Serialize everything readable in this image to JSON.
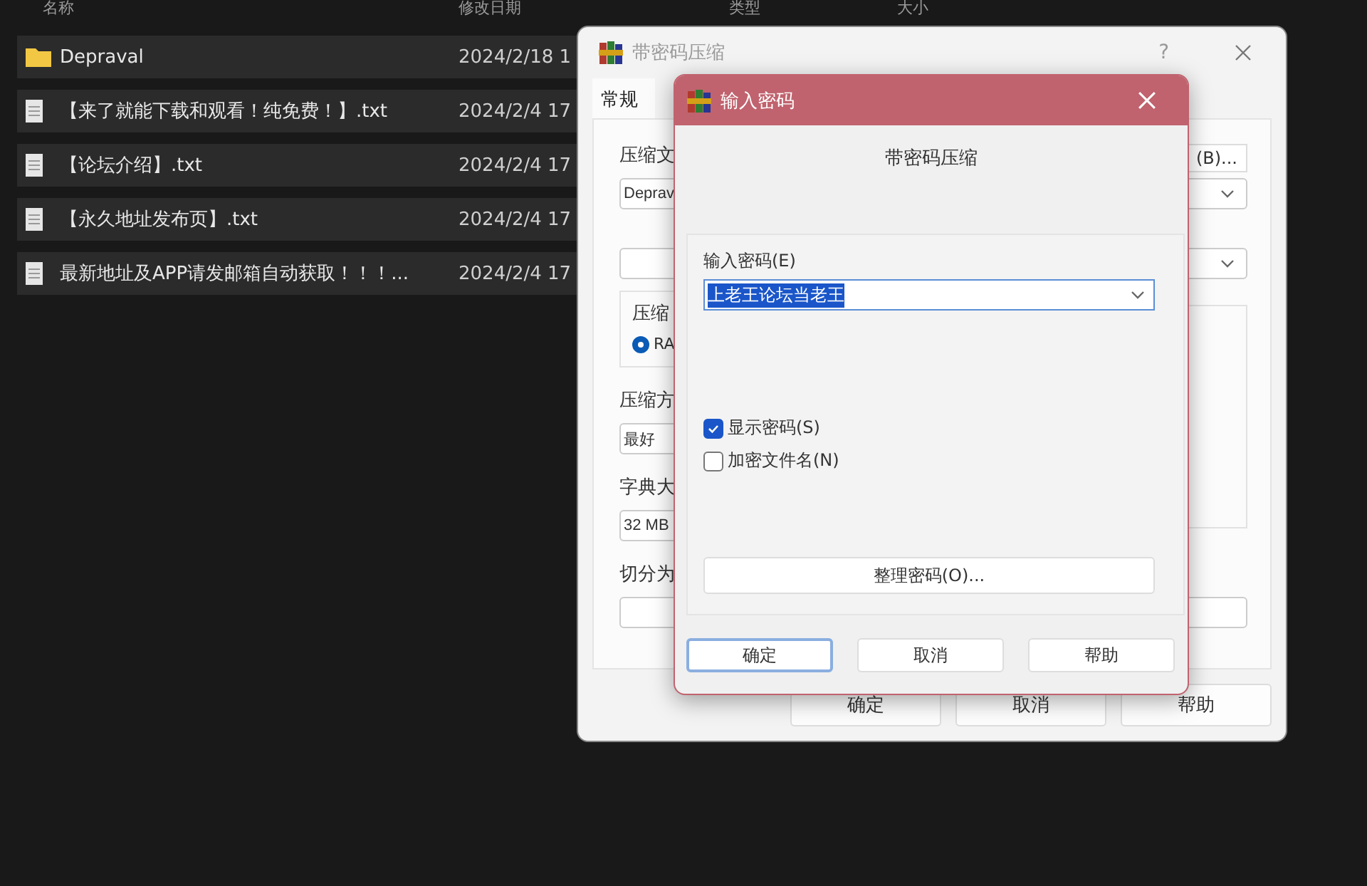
{
  "explorer": {
    "columns": [
      "名称",
      "修改日期",
      "类型",
      "大小"
    ],
    "rows": [
      {
        "kind": "folder",
        "name": "Depraval",
        "modified": "2024/2/18 1"
      },
      {
        "kind": "file",
        "name": "【来了就能下载和观看！纯免费！】.txt",
        "modified": "2024/2/4 17"
      },
      {
        "kind": "file",
        "name": "【论坛介绍】.txt",
        "modified": "2024/2/4 17"
      },
      {
        "kind": "file",
        "name": "【永久地址发布页】.txt",
        "modified": "2024/2/4 17"
      },
      {
        "kind": "file",
        "name": "最新地址及APP请发邮箱自动获取！！！...",
        "modified": "2024/2/4 17"
      }
    ]
  },
  "back_dialog": {
    "title": "带密码压缩",
    "help": "?",
    "tabs": [
      {
        "label": "常规",
        "selected": true
      }
    ],
    "archive_label": "压缩文",
    "browse_button": "(B)...",
    "archive_name": "Deprav",
    "format_group": "压缩",
    "format_radio": {
      "label": "RA",
      "selected": true
    },
    "method_label": "压缩方",
    "method_value": "最好",
    "dictionary_label": "字典大",
    "dictionary_value": "32 MB",
    "split_label": "切分为",
    "buttons": [
      "确定",
      "取消",
      "帮助"
    ]
  },
  "front_dialog": {
    "title": "输入密码",
    "heading": "带密码压缩",
    "password_label": "输入密码(E)",
    "password": {
      "value": "上老王论坛当老王",
      "selected": true
    },
    "options": [
      {
        "label": "显示密码(S)",
        "checked": true
      },
      {
        "label": "加密文件名(N)",
        "checked": false
      }
    ],
    "organize_button": "整理密码(O)...",
    "buttons": [
      {
        "label": "确定",
        "focused": true
      },
      {
        "label": "取消",
        "focused": false
      },
      {
        "label": "帮助",
        "focused": false
      }
    ]
  }
}
